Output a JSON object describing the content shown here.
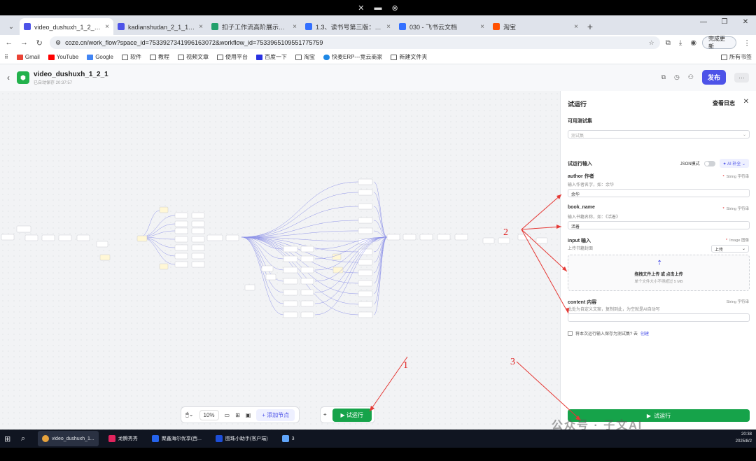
{
  "browser": {
    "tabs": [
      {
        "label": "video_dushuxh_1_2_1 - 工作流",
        "color": "#4d53e8",
        "active": true
      },
      {
        "label": "kadianshudan_2_1_1 - 工作流",
        "color": "#4d53e8",
        "active": false
      },
      {
        "label": "扣子工作流高阶展示与教程 - 飞书",
        "color": "#22a06b",
        "active": false
      },
      {
        "label": "1.3、读书号第三版：滚动字幕",
        "color": "#3370ff",
        "active": false
      },
      {
        "label": "030 - 飞书云文档",
        "color": "#3370ff",
        "active": false
      },
      {
        "label": "淘宝",
        "color": "#ff5000",
        "active": false
      }
    ],
    "url": "coze.cn/work_flow?space_id=7533927341996163072&workflow_id=7533965109551775759",
    "update_label": "完成更新",
    "bookmarks": [
      "Gmail",
      "YouTube",
      "Google",
      "软件",
      "教程",
      "视频文章",
      "使用平台",
      "百度一下",
      "淘宝",
      "快麦ERP---竞云商家",
      "新建文件夹"
    ],
    "bookmarks_right": "所有书签"
  },
  "app": {
    "title": "video_dushuxh_1_2_1",
    "subtitle": "已自动保存 20:37:57",
    "publish_label": "发布"
  },
  "toolbar": {
    "zoom": "10%",
    "add_node": "添加节点",
    "run": "试运行"
  },
  "panel": {
    "title": "试运行",
    "view_log": "查看日志",
    "testset_label": "可用测试集",
    "testset_placeholder": "测试集",
    "input_label": "试运行输入",
    "json_mode": "JSON模式",
    "ai_fill": "AI 补全",
    "fields": [
      {
        "name": "author 作者",
        "type": "String 字符串",
        "hint": "输入作者名字，如：余华",
        "value": "余华"
      },
      {
        "name": "book_name",
        "type": "String 字符串",
        "hint": "输入书籍名称，如：《活着》",
        "value": "活着"
      },
      {
        "name": "input 输入",
        "type": "Image 图像",
        "hint": "上传书籍封面",
        "value": ""
      },
      {
        "name": "content 内容",
        "type": "String 字符串",
        "hint": "此处为自定义文案，复制到此，为空就是AI自动写",
        "value": ""
      }
    ],
    "upload_select": "上传",
    "upload_title": "拖拽文件上传 或 点击上传",
    "upload_hint": "单个文件大小不得超过 5 MB",
    "save_text": "将本次运行输入保存为测试集? 去",
    "save_link": "创建",
    "run_label": "试运行"
  },
  "annotations": [
    "1",
    "2",
    "3"
  ],
  "taskbar": {
    "apps": [
      "video_dushuxh_1...",
      "龙腾秀秀",
      "聚鑫海尔优享(西...",
      "图珠小助手(客户端)",
      "3"
    ],
    "time": "20:38",
    "date": "2025/8/2"
  },
  "watermark": "公众号 · 子文AI"
}
